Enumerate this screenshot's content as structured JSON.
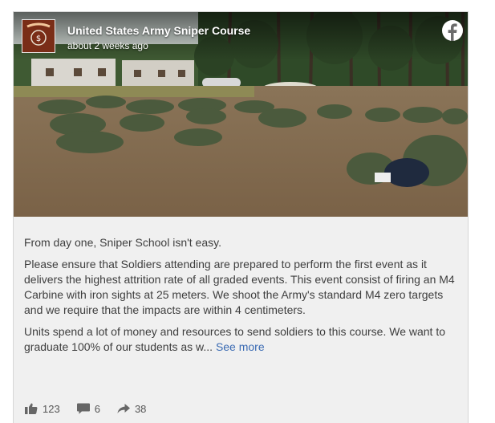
{
  "post": {
    "page_name": "United States Army Sniper Course",
    "time": "about 2 weeks ago",
    "avatar_icon": "sniper-course-logo",
    "platform_icon": "facebook-icon",
    "paragraphs": [
      "From day one, Sniper School isn't easy.",
      "Please ensure that Soldiers attending are prepared to perform the first event as it delivers the highest attrition rate of all graded events. This event consist of firing an M4 Carbine with iron sights at 25 meters. We shoot the Army's standard M4 zero targets and we require that the impacts are within 4 centimeters."
    ],
    "last_paragraph": "Units spend a lot of money and resources to send soldiers to this course. We want to graduate 100% of our students as w...",
    "see_more": "See more",
    "stats": {
      "likes": "123",
      "comments": "6",
      "shares": "38"
    }
  },
  "colors": {
    "link": "#3b6bb3",
    "card_bg": "#f0f0f0",
    "text": "#3e3e3e"
  }
}
